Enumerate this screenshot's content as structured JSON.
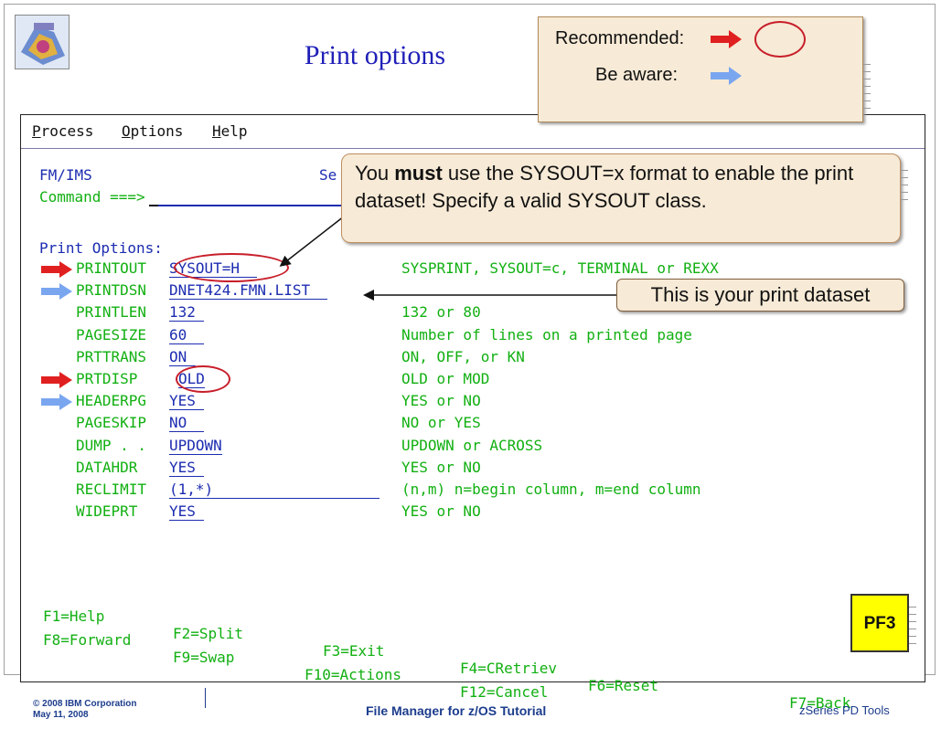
{
  "slide": {
    "title": "Print options",
    "footer_left_1": "© 2008 IBM Corporation",
    "footer_left_2": "May 11, 2008",
    "footer_center": "File Manager for z/OS Tutorial",
    "footer_right": "zSeries PD Tools"
  },
  "legend": {
    "recommended_label": "Recommended:",
    "aware_label": "Be aware:",
    "recommended_color": "#e02020",
    "aware_color": "#7aa6f0"
  },
  "callouts": {
    "must_pre": "You ",
    "must_bold": "must",
    "must_post": " use the SYSOUT=x format to enable the print dataset! Specify a valid SYSOUT class.",
    "dataset": "This is your print dataset",
    "pf3": "PF3"
  },
  "menubar": {
    "process_u": "P",
    "process_rest": "rocess",
    "options_u": "O",
    "options_rest": "ptions",
    "help_u": "H",
    "help_rest": "elp"
  },
  "header": {
    "panel_id": "FM/IMS",
    "se": "Se",
    "command_label": "Command ===>",
    "command_value": ""
  },
  "section_title": "Print Options:",
  "options": [
    {
      "name": "PRINTOUT",
      "value": "SYSOUT=H",
      "desc": "SYSPRINT, SYSOUT=c, TERMINAL or REXX",
      "marker": "recommended"
    },
    {
      "name": "PRINTDSN",
      "value": "DNET424.FMN.LIST",
      "desc": "",
      "marker": "aware"
    },
    {
      "name": "PRINTLEN",
      "value": "132",
      "desc": "132 or 80",
      "marker": ""
    },
    {
      "name": "PAGESIZE",
      "value": "60",
      "desc": "Number of lines on a printed page",
      "marker": ""
    },
    {
      "name": "PRTTRANS",
      "value": "ON",
      "desc": "ON, OFF, or KN",
      "marker": ""
    },
    {
      "name": "PRTDISP",
      "value": "OLD",
      "desc": "OLD or MOD",
      "marker": "recommended"
    },
    {
      "name": "HEADERPG",
      "value": "YES",
      "desc": "YES or NO",
      "marker": "aware"
    },
    {
      "name": "PAGESKIP",
      "value": "NO",
      "desc": "NO or YES",
      "marker": ""
    },
    {
      "name": "DUMP . .",
      "value": "UPDOWN",
      "desc": "UPDOWN or ACROSS",
      "marker": ""
    },
    {
      "name": "DATAHDR",
      "value": "YES",
      "desc": "YES or NO",
      "marker": ""
    },
    {
      "name": "RECLIMIT",
      "value": "(1,*)",
      "desc": "(n,m) n=begin column, m=end column",
      "marker": ""
    },
    {
      "name": "WIDEPRT",
      "value": "YES",
      "desc": "YES or NO",
      "marker": ""
    }
  ],
  "fkeys_row1": [
    {
      "label": "F1=Help"
    },
    {
      "label": "F2=Split"
    },
    {
      "label": "F3=Exit"
    },
    {
      "label": "F4=CRetriev"
    },
    {
      "label": "F6=Reset"
    },
    {
      "label": "F7=Back"
    }
  ],
  "fkeys_row2": [
    {
      "label": "F8=Forward"
    },
    {
      "label": "F9=Swap"
    },
    {
      "label": "F10=Actions"
    },
    {
      "label": "F12=Cancel"
    }
  ]
}
